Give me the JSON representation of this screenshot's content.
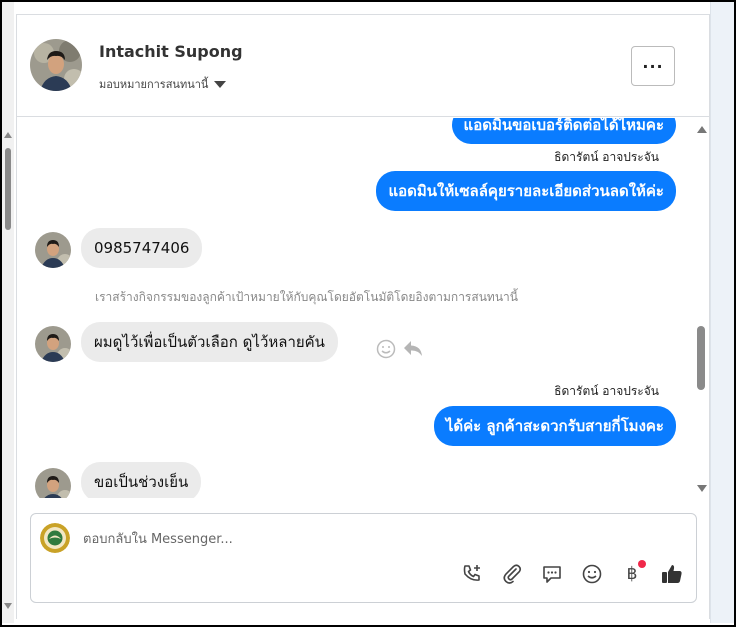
{
  "header": {
    "name": "Intachit Supong",
    "assign_label": "มอบหมายการสนทนานี้",
    "more_label": "···"
  },
  "messages": [
    {
      "type": "out",
      "text": "แอดมินขอเบอร์ติดต่อได้ไหมคะ"
    },
    {
      "type": "sender",
      "text": "ธิดารัตน์ อาจประจัน"
    },
    {
      "type": "out",
      "text": "แอดมินให้เซลล์คุยรายละเอียดส่วนลดให้ค่ะ"
    },
    {
      "type": "in",
      "text": "0985747406"
    },
    {
      "type": "system",
      "text": "เราสร้างกิจกรรมของลูกค้าเป้าหมายให้กับคุณโดยอัตโนมัติโดยอิงตามการสนทนานี้"
    },
    {
      "type": "in",
      "text": "ผมดูไว้เพื่อเป็นตัวเลือก ดูไว้หลายคัน"
    },
    {
      "type": "sender",
      "text": "ธิดารัตน์ อาจประจัน"
    },
    {
      "type": "out",
      "text": "ได้ค่ะ ลูกค้าสะดวกรับสายกี่โมงคะ"
    },
    {
      "type": "in",
      "text": "ขอเป็นช่วงเย็น"
    }
  ],
  "composer": {
    "placeholder": "ตอบกลับใน Messenger...",
    "tools": [
      "call-plus-icon",
      "paperclip-icon",
      "saved-reply-icon",
      "emoji-icon",
      "baht-icon",
      "thumbs-up-icon"
    ],
    "baht_symbol": "฿"
  },
  "colors": {
    "outgoing_bubble": "#0a7cff",
    "incoming_bubble": "#ebebeb",
    "notification_dot": "#f0284a"
  }
}
